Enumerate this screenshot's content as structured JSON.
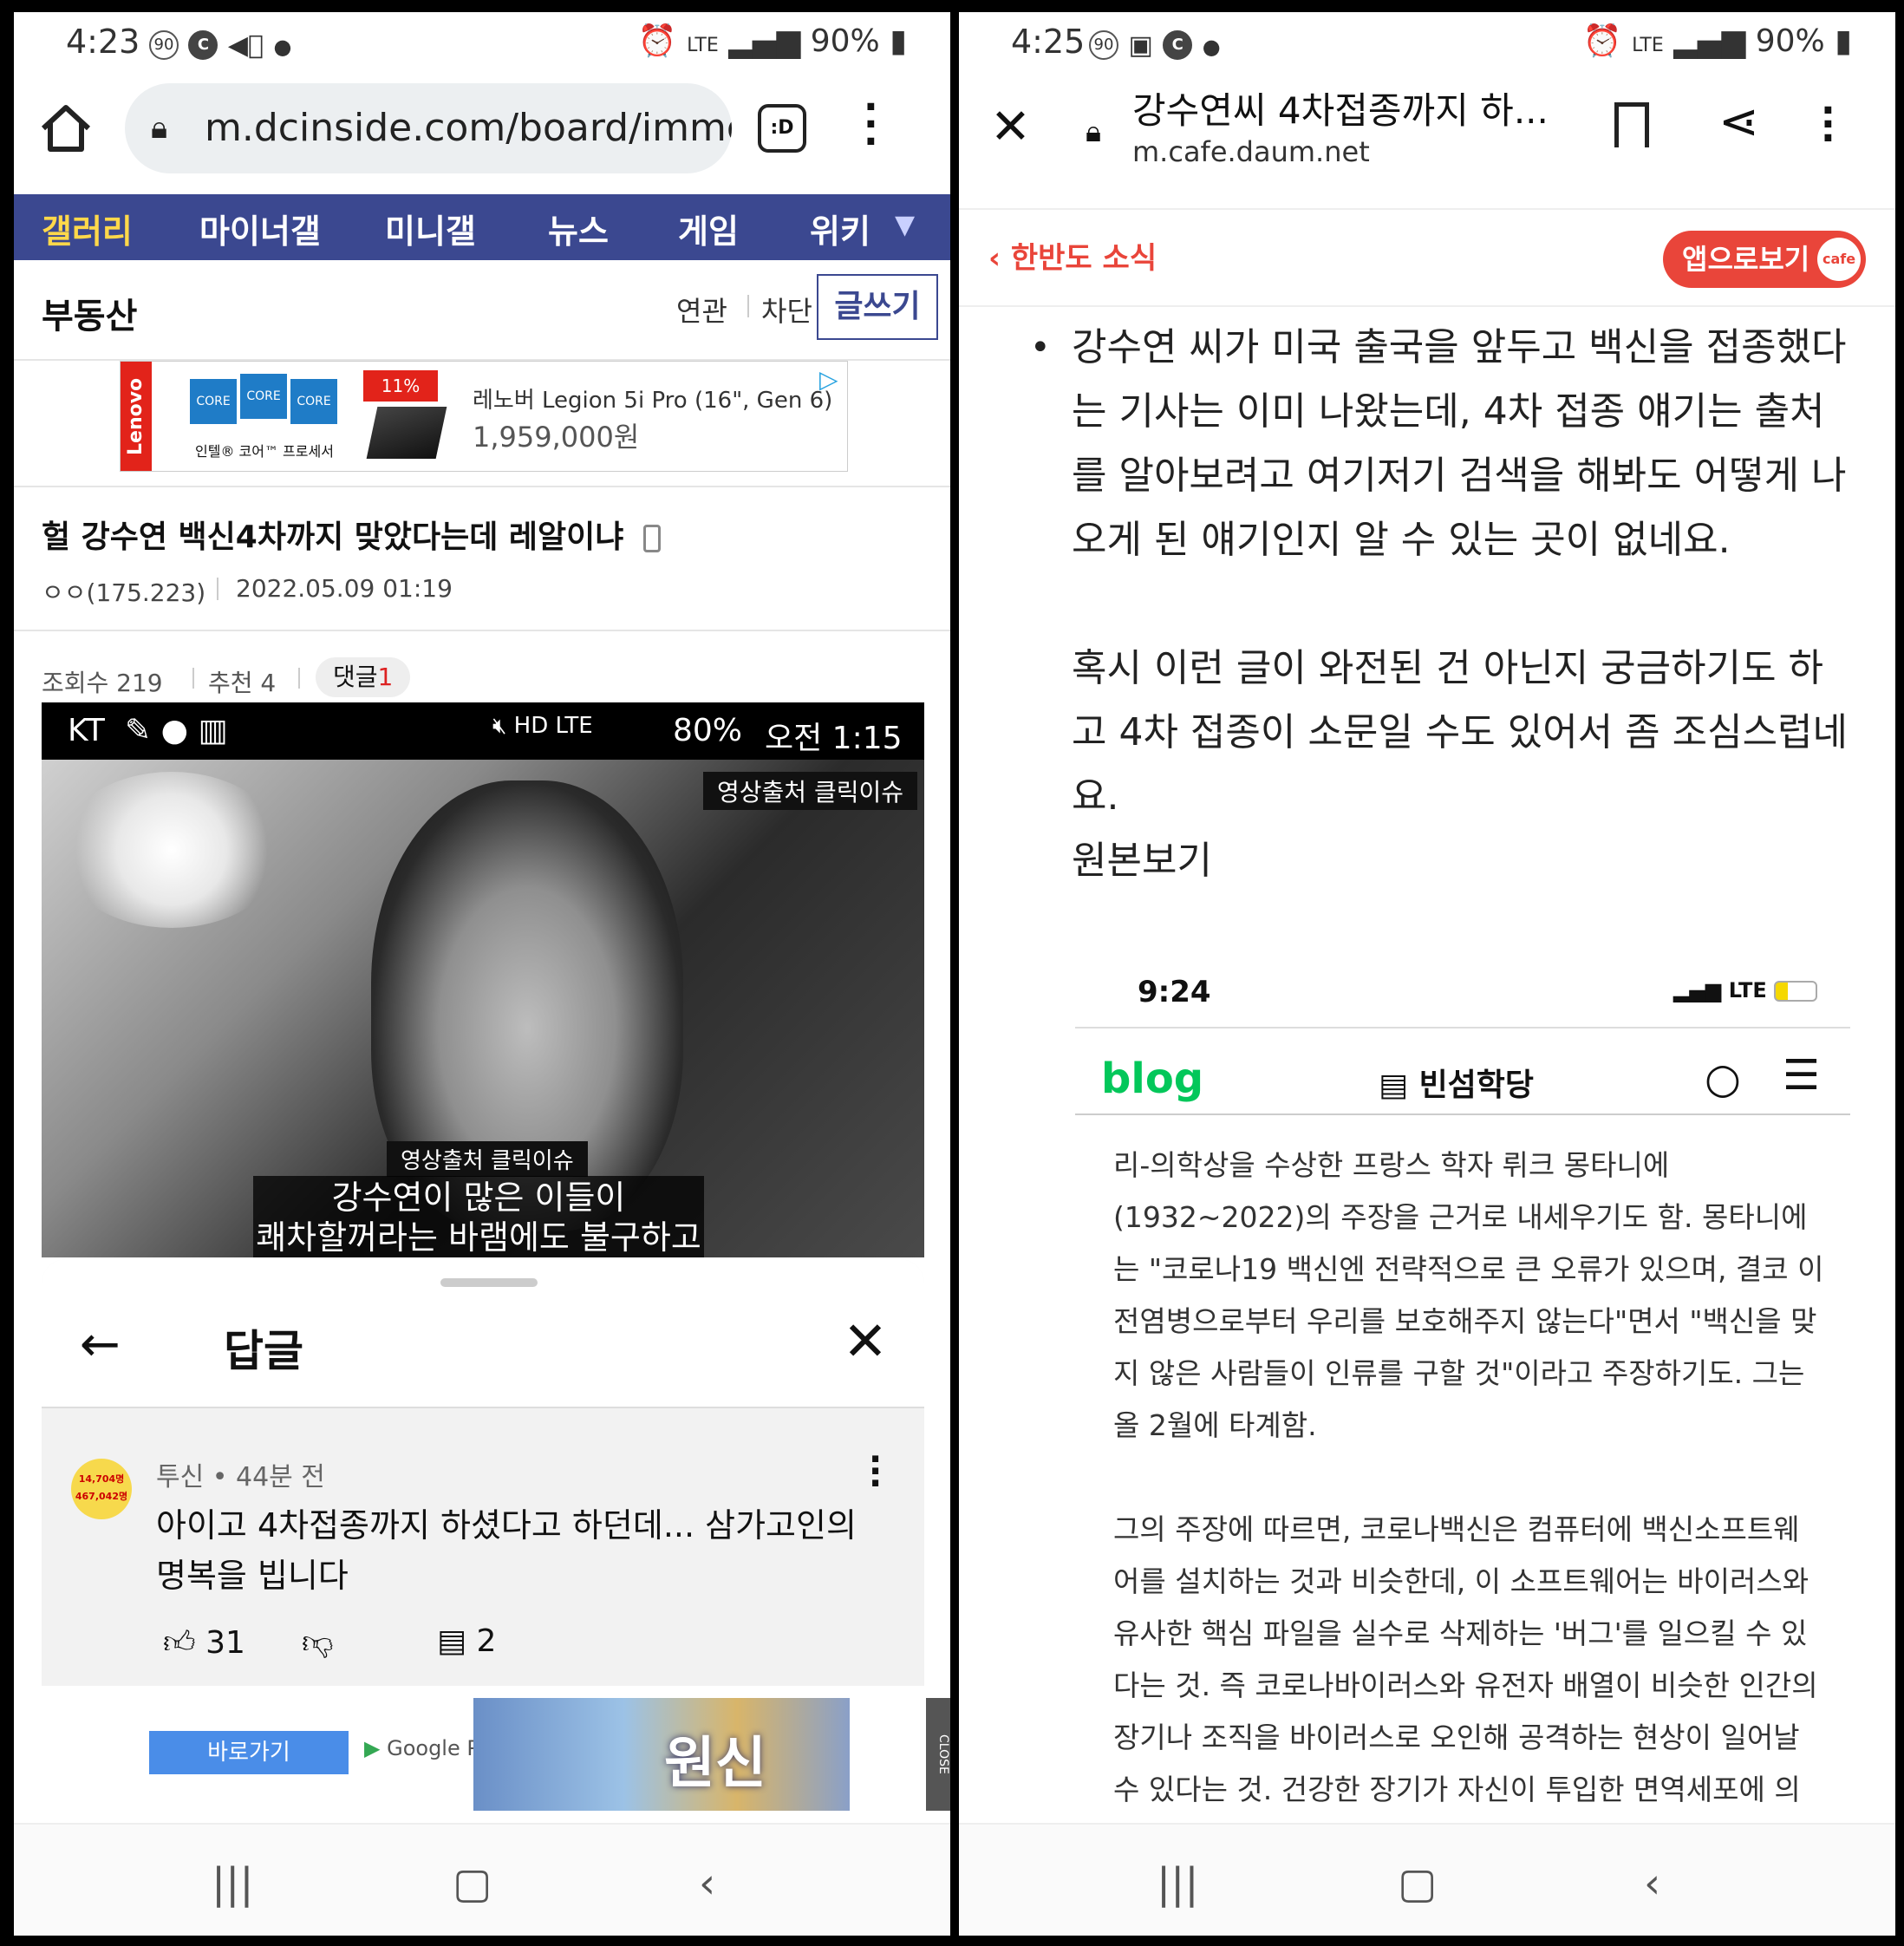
{
  "left": {
    "status_bar": {
      "time": "4:23",
      "battery": "90%",
      "network": "LTE"
    },
    "browser": {
      "url": "m.dcinside.com/board/immo",
      "tab_button": ":D"
    },
    "nav": [
      "갤러리",
      "마이너갤",
      "미니갤",
      "뉴스",
      "게임",
      "위키"
    ],
    "board": {
      "title": "부동산",
      "related": "연관",
      "block": "차단",
      "write": "글쓰기"
    },
    "ad": {
      "brand": "Lenovo",
      "chip_label": "CORE",
      "caption": "인텔® 코어™ 프로세서",
      "discount": "11%",
      "product": "레노버 Legion 5i Pro (16\", Gen 6)",
      "price": "1,959,000원"
    },
    "post": {
      "title": "헐 강수연 백신4차까지 맞았다는데 레알이냐",
      "author": "ㅇㅇ(175.223)",
      "date": "2022.05.09 01:19",
      "views": "조회수 219",
      "recommend": "추천 4",
      "comments_label": "댓글",
      "comments_count": "1"
    },
    "video": {
      "carrier": "KT",
      "battery": "80%",
      "time": "오전 1:15",
      "source_tag": "영상출처 클릭이슈",
      "subtitle_tag": "영상출처 클릭이슈",
      "subtitle_line1": "강수연이 많은 이들이",
      "subtitle_line2": "쾌차할꺼라는 바램에도 불구하고"
    },
    "reply_sheet": {
      "title": "답글",
      "avatar_text_1": "14,704명",
      "avatar_text_2": "467,042명",
      "author": "투신",
      "time": "44분 전",
      "comment": "아이고 4차접종까지 하셨다고 하던데... 삼가고인의 명복을 빕니다",
      "likes": "31",
      "replies": "2"
    },
    "bottom_ad": {
      "button": "바로가기",
      "store": "Google Play",
      "game_title": "원신",
      "close": "CLOSE"
    }
  },
  "right": {
    "status_bar": {
      "time": "4:25",
      "battery": "90%",
      "network": "LTE"
    },
    "browser": {
      "title": "강수연씨 4차접종까지 하...",
      "domain": "m.cafe.daum.net"
    },
    "cafe": {
      "back_label": "한반도 소식",
      "app_button": "앱으로보기",
      "app_logo": "cafe"
    },
    "article": {
      "paragraph1": "강수연 씨가 미국 출국을 앞두고 백신을 접종했다는 기사는 이미 나왔는데, 4차 접종 얘기는 출처를 알아보려고 여기저기 검색을 해봐도 어떻게 나오게 된 얘기인지 알 수 있는 곳이 없네요.",
      "paragraph2": "혹시 이런 글이 와전된 건 아닌지 궁금하기도 하고 4차 접종이 소문일 수도 있어서 좀 조심스럽네요.",
      "original_link": "원본보기"
    },
    "embed": {
      "time": "9:24",
      "network": "LTE",
      "blog_logo": "blog",
      "blog_name": "빈섬학당",
      "para1": "리-의학상을 수상한 프랑스 학자 뤼크 몽타니에(1932~2022)의 주장을 근거로 내세우기도 함. 몽타니에는 \"코로나19 백신엔 전략적으로 큰 오류가 있으며, 결코 이 전염병으로부터 우리를 보호해주지 않는다\"면서 \"백신을 맞지 않은 사람들이 인류를 구할 것\"이라고 주장하기도. 그는 올 2월에 타계함.",
      "para2": "그의 주장에 따르면, 코로나백신은 컴퓨터에 백신소프트웨어를 설치하는 것과 비슷한데, 이 소프트웨어는 바이러스와 유사한 핵심 파일을 실수로 삭제하는 '버그'를 일으킬 수 있다는 것. 즉 코로나바이러스와 유전자 배열이 비슷한 인간의 장기나 조직을 바이러스로 오인해 공격하는 현상이 일어날 수 있다는 것. 건강한 장기가 자신이 투입한 면역세포에 의해 공격을 받아 유해적 장애가 생길 수 있음. 세포"
    }
  },
  "colors": {
    "nav_bg": "#3b4890",
    "nav_active": "#ffd84a",
    "cafe_red": "#e9453a",
    "blog_green": "#03c75a"
  }
}
